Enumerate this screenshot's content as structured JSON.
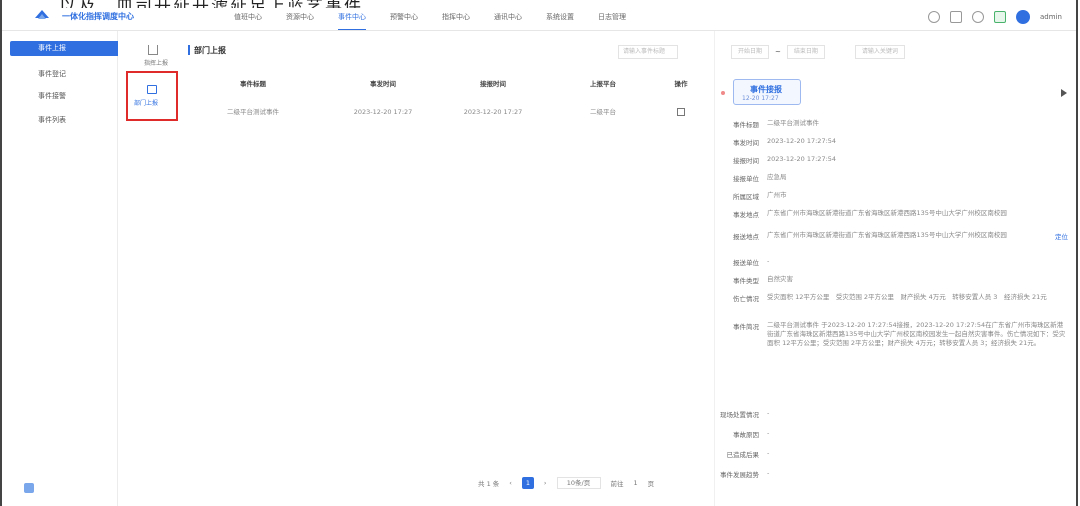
{
  "caption": "，以及，皿司开延开滤延足上蓝艺事件",
  "header": {
    "brand": "一体化指挥调度中心",
    "nav": [
      "值班中心",
      "资源中心",
      "事件中心",
      "预警中心",
      "指挥中心",
      "通讯中心",
      "系统设置",
      "日志管理"
    ],
    "active_nav_index": 2,
    "user": "admin"
  },
  "sidebar": {
    "items": [
      "事件上报",
      "事件登记",
      "事件接警",
      "事件列表"
    ],
    "active_index": 0
  },
  "subnav": {
    "top_label": "指挥上报",
    "selected_label": "部门上报"
  },
  "main": {
    "title": "部门上报",
    "search_placeholder": "请输入事件标题",
    "columns": [
      "事件标题",
      "事发时间",
      "接报时间",
      "上报平台",
      "操作"
    ],
    "rows": [
      {
        "title": "二级平台测试事件",
        "occur_time": "2023-12-20 17:27",
        "receive_time": "2023-12-20 17:27",
        "platform": "二级平台"
      }
    ],
    "pagination": {
      "total": "共 1 条",
      "page": "1",
      "page_size": "10条/页",
      "goto_label": "前往",
      "goto_value": "1",
      "goto_suffix": "页"
    }
  },
  "detail": {
    "filters": [
      "开始日期",
      "结束日期",
      "请输入关键词"
    ],
    "stage": {
      "title": "事件接报",
      "time": "12-20 17:27"
    },
    "fields": [
      {
        "k": "事件标题",
        "v": "二级平台测试事件"
      },
      {
        "k": "事发时间",
        "v": "2023-12-20 17:27:54"
      },
      {
        "k": "接报时间",
        "v": "2023-12-20 17:27:54"
      },
      {
        "k": "接报单位",
        "v": "应急局"
      },
      {
        "k": "所属区域",
        "v": "广州市"
      },
      {
        "k": "事发地点",
        "v": "广东省广州市海珠区新港街道广东省海珠区新港西路135号中山大学广州校区南校园"
      },
      {
        "k": "报送地点",
        "v": "广东省广州市海珠区新港街道广东省海珠区新港西路135号中山大学广州校区南校园"
      },
      {
        "k": "报送单位",
        "v": "-"
      },
      {
        "k": "事件类型",
        "v": "自然灾害"
      },
      {
        "k": "伤亡情况",
        "v": "受灾面积 12平方公里　受灾范围 2平方公里　财产损失 4万元　转移安置人员 3　经济损失 21元"
      },
      {
        "k": "事件简况",
        "v": "二级平台测试事件 于2023-12-20 17:27:54接报，2023-12-20 17:27:54在广东省广州市海珠区新港街道广东省海珠区新港西路135号中山大学广州校区南校园发生一起自然灾害事件。伤亡情况如下：受灾面积 12平方公里；受灾范围 2平方公里；财产损失 4万元；转移安置人员 3；经济损失 21元。"
      },
      {
        "k": "现场处置情况",
        "v": "-"
      },
      {
        "k": "事故原因",
        "v": "-"
      },
      {
        "k": "已造成后果",
        "v": "-"
      },
      {
        "k": "事件发展趋势",
        "v": "-"
      }
    ],
    "map_link": "定位"
  },
  "colors": {
    "primary": "#2f6fe0",
    "highlight_border": "#e02b2b"
  }
}
